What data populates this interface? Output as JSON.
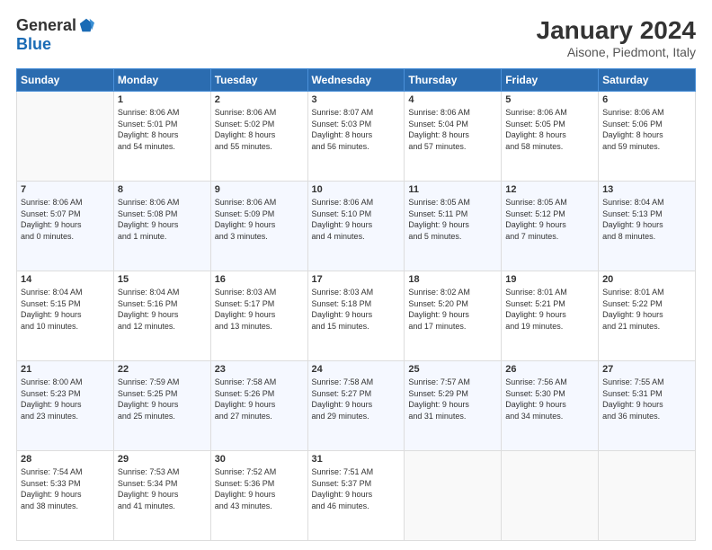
{
  "logo": {
    "general": "General",
    "blue": "Blue"
  },
  "title": "January 2024",
  "subtitle": "Aisone, Piedmont, Italy",
  "days_of_week": [
    "Sunday",
    "Monday",
    "Tuesday",
    "Wednesday",
    "Thursday",
    "Friday",
    "Saturday"
  ],
  "weeks": [
    [
      {
        "day": "",
        "sunrise": "",
        "sunset": "",
        "daylight": ""
      },
      {
        "day": "1",
        "sunrise": "Sunrise: 8:06 AM",
        "sunset": "Sunset: 5:01 PM",
        "daylight": "Daylight: 8 hours and 54 minutes."
      },
      {
        "day": "2",
        "sunrise": "Sunrise: 8:06 AM",
        "sunset": "Sunset: 5:02 PM",
        "daylight": "Daylight: 8 hours and 55 minutes."
      },
      {
        "day": "3",
        "sunrise": "Sunrise: 8:07 AM",
        "sunset": "Sunset: 5:03 PM",
        "daylight": "Daylight: 8 hours and 56 minutes."
      },
      {
        "day": "4",
        "sunrise": "Sunrise: 8:06 AM",
        "sunset": "Sunset: 5:04 PM",
        "daylight": "Daylight: 8 hours and 57 minutes."
      },
      {
        "day": "5",
        "sunrise": "Sunrise: 8:06 AM",
        "sunset": "Sunset: 5:05 PM",
        "daylight": "Daylight: 8 hours and 58 minutes."
      },
      {
        "day": "6",
        "sunrise": "Sunrise: 8:06 AM",
        "sunset": "Sunset: 5:06 PM",
        "daylight": "Daylight: 8 hours and 59 minutes."
      }
    ],
    [
      {
        "day": "7",
        "sunrise": "Sunrise: 8:06 AM",
        "sunset": "Sunset: 5:07 PM",
        "daylight": "Daylight: 9 hours and 0 minutes."
      },
      {
        "day": "8",
        "sunrise": "Sunrise: 8:06 AM",
        "sunset": "Sunset: 5:08 PM",
        "daylight": "Daylight: 9 hours and 1 minute."
      },
      {
        "day": "9",
        "sunrise": "Sunrise: 8:06 AM",
        "sunset": "Sunset: 5:09 PM",
        "daylight": "Daylight: 9 hours and 3 minutes."
      },
      {
        "day": "10",
        "sunrise": "Sunrise: 8:06 AM",
        "sunset": "Sunset: 5:10 PM",
        "daylight": "Daylight: 9 hours and 4 minutes."
      },
      {
        "day": "11",
        "sunrise": "Sunrise: 8:05 AM",
        "sunset": "Sunset: 5:11 PM",
        "daylight": "Daylight: 9 hours and 5 minutes."
      },
      {
        "day": "12",
        "sunrise": "Sunrise: 8:05 AM",
        "sunset": "Sunset: 5:12 PM",
        "daylight": "Daylight: 9 hours and 7 minutes."
      },
      {
        "day": "13",
        "sunrise": "Sunrise: 8:04 AM",
        "sunset": "Sunset: 5:13 PM",
        "daylight": "Daylight: 9 hours and 8 minutes."
      }
    ],
    [
      {
        "day": "14",
        "sunrise": "Sunrise: 8:04 AM",
        "sunset": "Sunset: 5:15 PM",
        "daylight": "Daylight: 9 hours and 10 minutes."
      },
      {
        "day": "15",
        "sunrise": "Sunrise: 8:04 AM",
        "sunset": "Sunset: 5:16 PM",
        "daylight": "Daylight: 9 hours and 12 minutes."
      },
      {
        "day": "16",
        "sunrise": "Sunrise: 8:03 AM",
        "sunset": "Sunset: 5:17 PM",
        "daylight": "Daylight: 9 hours and 13 minutes."
      },
      {
        "day": "17",
        "sunrise": "Sunrise: 8:03 AM",
        "sunset": "Sunset: 5:18 PM",
        "daylight": "Daylight: 9 hours and 15 minutes."
      },
      {
        "day": "18",
        "sunrise": "Sunrise: 8:02 AM",
        "sunset": "Sunset: 5:20 PM",
        "daylight": "Daylight: 9 hours and 17 minutes."
      },
      {
        "day": "19",
        "sunrise": "Sunrise: 8:01 AM",
        "sunset": "Sunset: 5:21 PM",
        "daylight": "Daylight: 9 hours and 19 minutes."
      },
      {
        "day": "20",
        "sunrise": "Sunrise: 8:01 AM",
        "sunset": "Sunset: 5:22 PM",
        "daylight": "Daylight: 9 hours and 21 minutes."
      }
    ],
    [
      {
        "day": "21",
        "sunrise": "Sunrise: 8:00 AM",
        "sunset": "Sunset: 5:23 PM",
        "daylight": "Daylight: 9 hours and 23 minutes."
      },
      {
        "day": "22",
        "sunrise": "Sunrise: 7:59 AM",
        "sunset": "Sunset: 5:25 PM",
        "daylight": "Daylight: 9 hours and 25 minutes."
      },
      {
        "day": "23",
        "sunrise": "Sunrise: 7:58 AM",
        "sunset": "Sunset: 5:26 PM",
        "daylight": "Daylight: 9 hours and 27 minutes."
      },
      {
        "day": "24",
        "sunrise": "Sunrise: 7:58 AM",
        "sunset": "Sunset: 5:27 PM",
        "daylight": "Daylight: 9 hours and 29 minutes."
      },
      {
        "day": "25",
        "sunrise": "Sunrise: 7:57 AM",
        "sunset": "Sunset: 5:29 PM",
        "daylight": "Daylight: 9 hours and 31 minutes."
      },
      {
        "day": "26",
        "sunrise": "Sunrise: 7:56 AM",
        "sunset": "Sunset: 5:30 PM",
        "daylight": "Daylight: 9 hours and 34 minutes."
      },
      {
        "day": "27",
        "sunrise": "Sunrise: 7:55 AM",
        "sunset": "Sunset: 5:31 PM",
        "daylight": "Daylight: 9 hours and 36 minutes."
      }
    ],
    [
      {
        "day": "28",
        "sunrise": "Sunrise: 7:54 AM",
        "sunset": "Sunset: 5:33 PM",
        "daylight": "Daylight: 9 hours and 38 minutes."
      },
      {
        "day": "29",
        "sunrise": "Sunrise: 7:53 AM",
        "sunset": "Sunset: 5:34 PM",
        "daylight": "Daylight: 9 hours and 41 minutes."
      },
      {
        "day": "30",
        "sunrise": "Sunrise: 7:52 AM",
        "sunset": "Sunset: 5:36 PM",
        "daylight": "Daylight: 9 hours and 43 minutes."
      },
      {
        "day": "31",
        "sunrise": "Sunrise: 7:51 AM",
        "sunset": "Sunset: 5:37 PM",
        "daylight": "Daylight: 9 hours and 46 minutes."
      },
      {
        "day": "",
        "sunrise": "",
        "sunset": "",
        "daylight": ""
      },
      {
        "day": "",
        "sunrise": "",
        "sunset": "",
        "daylight": ""
      },
      {
        "day": "",
        "sunrise": "",
        "sunset": "",
        "daylight": ""
      }
    ]
  ]
}
